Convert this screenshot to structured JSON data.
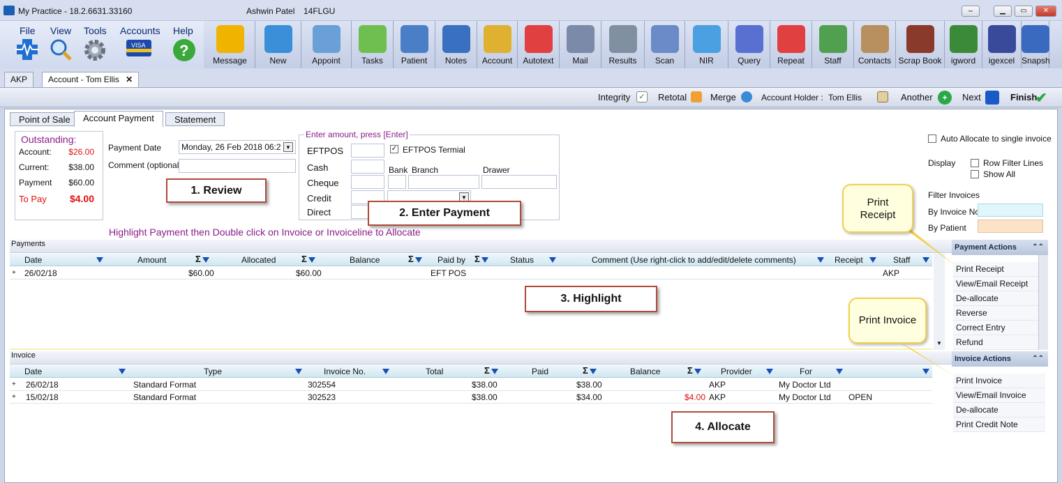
{
  "window": {
    "title": "My Practice - 18.2.6631.33160",
    "user": "Ashwin Patel",
    "location": "14FLGU"
  },
  "menu": [
    {
      "label": "File",
      "icon": "heartbeat-icon"
    },
    {
      "label": "View",
      "icon": "magnifier-icon"
    },
    {
      "label": "Tools",
      "icon": "gear-icon"
    },
    {
      "label": "Accounts",
      "icon": "credit-card-icon"
    },
    {
      "label": "Help",
      "icon": "help-icon"
    }
  ],
  "toolbar": [
    {
      "label": "Message",
      "icon": "speech-bubble-icon",
      "color": "#f0b400"
    },
    {
      "label": "New",
      "icon": "new-patient-icon",
      "color": "#3a8fd8"
    },
    {
      "label": "Appoint",
      "icon": "calendar-icon",
      "color": "#6aa0d8"
    },
    {
      "label": "Tasks",
      "icon": "checklist-icon",
      "color": "#6fbf50"
    },
    {
      "label": "Patient",
      "icon": "patient-card-icon",
      "color": "#4a7fc8"
    },
    {
      "label": "Notes",
      "icon": "notepad-icon",
      "color": "#3a70c0"
    },
    {
      "label": "Account",
      "icon": "coins-icon",
      "color": "#e0b030"
    },
    {
      "label": "Autotext",
      "icon": "spellcheck-icon",
      "color": "#e04040"
    },
    {
      "label": "Mail",
      "icon": "mail-icon",
      "color": "#7a8aa8"
    },
    {
      "label": "Results",
      "icon": "microscope-icon",
      "color": "#8090a0"
    },
    {
      "label": "Scan",
      "icon": "scanner-icon",
      "color": "#6a8ac8"
    },
    {
      "label": "NIR",
      "icon": "syringe-icon",
      "color": "#4aa0e0"
    },
    {
      "label": "Query",
      "icon": "query-magnifier-icon",
      "color": "#5a70d0"
    },
    {
      "label": "Repeat",
      "icon": "pill-icon",
      "color": "#e04040"
    },
    {
      "label": "Staff",
      "icon": "staff-icon",
      "color": "#50a050"
    },
    {
      "label": "Contacts",
      "icon": "address-book-icon",
      "color": "#b89060"
    },
    {
      "label": "Scrap Book",
      "icon": "scrapbook-icon",
      "color": "#8a3a2a"
    },
    {
      "label": "igword",
      "icon": "igword-icon",
      "color": "#3a8a3a"
    },
    {
      "label": "igexcel",
      "icon": "igexcel-icon",
      "color": "#3a4a9a"
    },
    {
      "label": "Snapsh",
      "icon": "snapshot-icon",
      "color": "#3a6ac0"
    }
  ],
  "doc_tabs": [
    {
      "label": "AKP"
    },
    {
      "label": "Account - Tom Ellis"
    }
  ],
  "actions": {
    "integrity": "Integrity",
    "retotal": "Retotal",
    "merge": "Merge",
    "holder_label": "Account Holder :",
    "holder_name": "Tom Ellis",
    "another": "Another",
    "next": "Next",
    "finish": "Finish"
  },
  "sub_tabs": [
    "Point of Sale",
    "Account Payment",
    "Statement"
  ],
  "outstanding": {
    "title": "Outstanding:",
    "rows": [
      {
        "label": "Account:",
        "value": "$26.00",
        "color": "#e01010"
      },
      {
        "label": "Current:",
        "value": "$38.00",
        "color": "#111111"
      },
      {
        "label": "Payment",
        "value": "$60.00",
        "color": "#111111"
      },
      {
        "label": "To Pay",
        "value": "$4.00",
        "color": "#e01010"
      }
    ]
  },
  "payment_form": {
    "date_label": "Payment Date",
    "date_value": "Monday, 26 Feb 2018  06:2",
    "comment_label": "Comment (optional)"
  },
  "enter_amount": {
    "title": "Enter amount, press [Enter]",
    "eftpos": "EFTPOS",
    "eftpos_terminal": "EFTPOS Termial",
    "cash": "Cash",
    "cheque": "Cheque",
    "credit": "Credit",
    "direct": "Direct",
    "bank": "Bank",
    "branch": "Branch",
    "drawer": "Drawer"
  },
  "options": {
    "auto_allocate": "Auto Allocate to single invoice",
    "display": "Display",
    "row_filter": "Row Filter Lines",
    "show_all": "Show All",
    "filter_invoices": "Filter Invoices",
    "by_invoice": "By Invoice No",
    "by_patient": "By Patient"
  },
  "instruction": "Highlight Payment then Double click on Invoice or Invoiceline to Allocate",
  "callouts": {
    "review": "1. Review",
    "enter_payment": "2. Enter Payment",
    "highlight": "3. Highlight",
    "allocate": "4. Allocate",
    "print_receipt": "Print Receipt",
    "print_invoice": "Print Invoice"
  },
  "payments": {
    "title": "Payments",
    "columns": [
      "Date",
      "Amount",
      "Allocated",
      "Balance",
      "Paid by",
      "Status",
      "Comment  (Use right-click to add/edit/delete comments)",
      "Receipt",
      "Staff"
    ],
    "rows": [
      {
        "date": "26/02/18",
        "amount": "$60.00",
        "allocated": "$60.00",
        "balance": "",
        "paid_by": "EFT POS",
        "status": "",
        "comment": "",
        "receipt": "",
        "staff": "AKP"
      }
    ]
  },
  "payment_actions": {
    "title": "Payment Actions",
    "items": [
      "Print Receipt",
      "View/Email Receipt",
      "De-allocate",
      "Reverse",
      "Correct Entry",
      "Refund"
    ]
  },
  "invoice": {
    "title": "Invoice",
    "columns": [
      "Date",
      "Type",
      "Invoice No.",
      "Total",
      "Paid",
      "Balance",
      "Provider",
      "For"
    ],
    "rows": [
      {
        "date": "26/02/18",
        "type": "Standard Format",
        "no": "302554",
        "total": "$38.00",
        "paid": "$38.00",
        "balance": "",
        "provider": "AKP",
        "for": "My Doctor Ltd",
        "status": ""
      },
      {
        "date": "15/02/18",
        "type": "Standard Format",
        "no": "302523",
        "total": "$38.00",
        "paid": "$34.00",
        "balance": "$4.00",
        "provider": "AKP",
        "for": "My Doctor Ltd",
        "status": "OPEN"
      }
    ]
  },
  "invoice_actions": {
    "title": "Invoice Actions",
    "items": [
      "Print Invoice",
      "View/Email Invoice",
      "De-allocate",
      "Print Credit Note"
    ]
  }
}
